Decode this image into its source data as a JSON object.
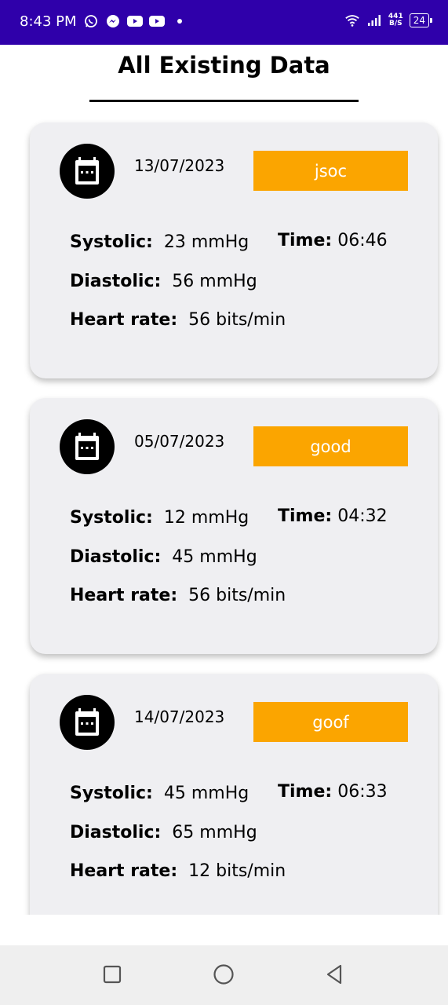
{
  "status_bar": {
    "time": "8:43 PM",
    "network_speed_value": "441",
    "network_speed_unit": "B/S",
    "battery": "24",
    "icons": [
      "whatsapp-icon",
      "messenger-icon",
      "youtube-icon",
      "youtube-icon",
      "wifi-icon",
      "signal-icon",
      "battery-icon"
    ]
  },
  "header": {
    "title": "All Existing Data"
  },
  "labels": {
    "systolic": "Systolic:",
    "diastolic": "Diastolic:",
    "heart_rate": "Heart rate:",
    "time": "Time:"
  },
  "records": [
    {
      "date": "13/07/2023",
      "status": "jsoc",
      "systolic": "23 mmHg",
      "diastolic": "56 mmHg",
      "heart_rate": "56 bits/min",
      "time": "06:46"
    },
    {
      "date": "05/07/2023",
      "status": "good",
      "systolic": "12 mmHg",
      "diastolic": "45 mmHg",
      "heart_rate": "56 bits/min",
      "time": "04:32"
    },
    {
      "date": "14/07/2023",
      "status": "goof",
      "systolic": "45 mmHg",
      "diastolic": "65 mmHg",
      "heart_rate": "12 bits/min",
      "time": "06:33"
    }
  ],
  "colors": {
    "status_bar": "#2f00aa",
    "badge": "#fba500",
    "card": "#efeff2"
  }
}
